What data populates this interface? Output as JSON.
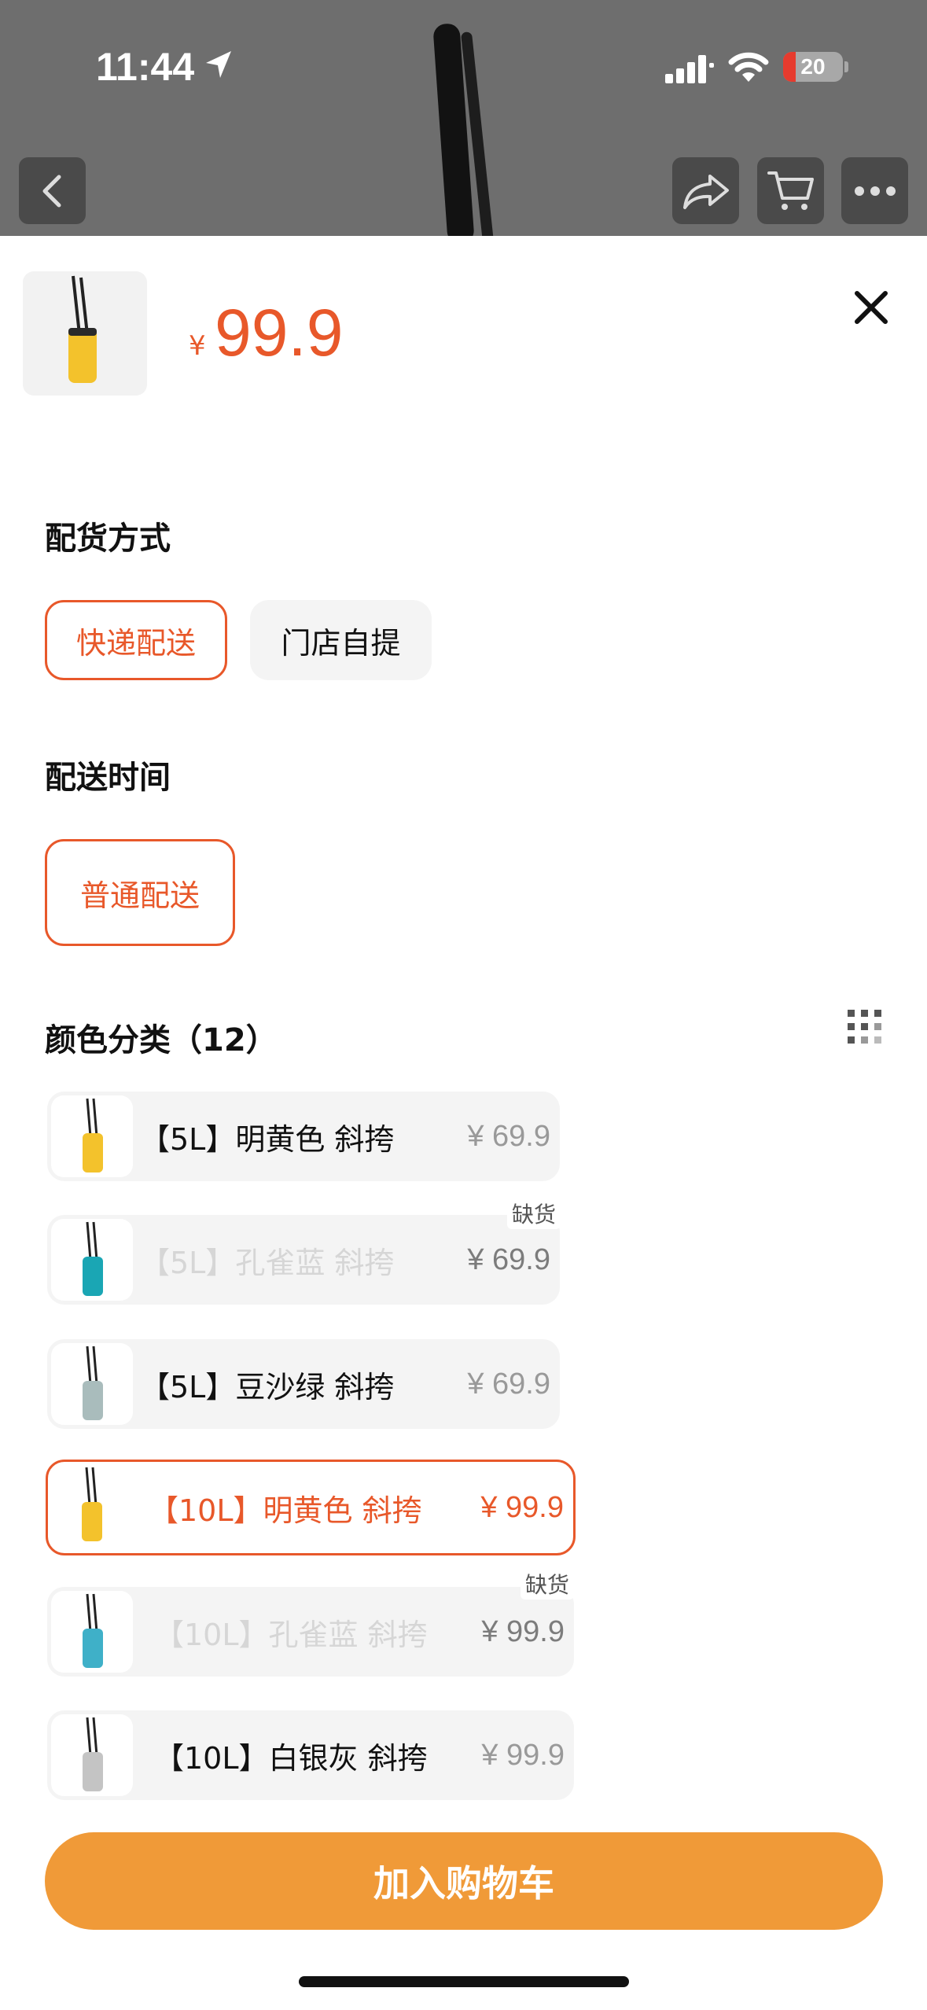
{
  "status": {
    "time": "11:44",
    "battery": "20"
  },
  "nav": {
    "icons": [
      "back-icon",
      "share-icon",
      "cart-icon",
      "more-icon"
    ]
  },
  "product": {
    "currency": "¥",
    "price": "99.9"
  },
  "delivery": {
    "title": "配货方式",
    "options": [
      {
        "label": "快递配送",
        "selected": true
      },
      {
        "label": "门店自提",
        "selected": false
      }
    ]
  },
  "time": {
    "title": "配送时间",
    "options": [
      {
        "label": "普通配送",
        "selected": true
      }
    ]
  },
  "colors": {
    "title": "颜色分类（12）",
    "items": [
      {
        "label": "【5L】明黄色 斜挎",
        "price": "¥ 69.9",
        "state": "normal",
        "color": "#f3c22c"
      },
      {
        "label": "【5L】孔雀蓝 斜挎",
        "price": "¥ 69.9",
        "state": "out_of_stock",
        "badge": "缺货",
        "color": "#1aa6b4"
      },
      {
        "label": "【5L】豆沙绿 斜挎",
        "price": "¥ 69.9",
        "state": "normal",
        "color": "#a9bcbc"
      },
      {
        "label": "【10L】明黄色 斜挎",
        "price": "¥ 99.9",
        "state": "selected",
        "color": "#f3c22c"
      },
      {
        "label": "【10L】孔雀蓝 斜挎",
        "price": "¥ 99.9",
        "state": "out_of_stock",
        "badge": "缺货",
        "color": "#3fb0c8"
      },
      {
        "label": "【10L】白银灰 斜挎",
        "price": "¥ 99.9",
        "state": "normal",
        "color": "#c4c4c4"
      }
    ]
  },
  "actions": {
    "add_to_cart": "加入购物车"
  },
  "colors_theme": {
    "accent": "#e8582a",
    "button": "#f09a38"
  }
}
